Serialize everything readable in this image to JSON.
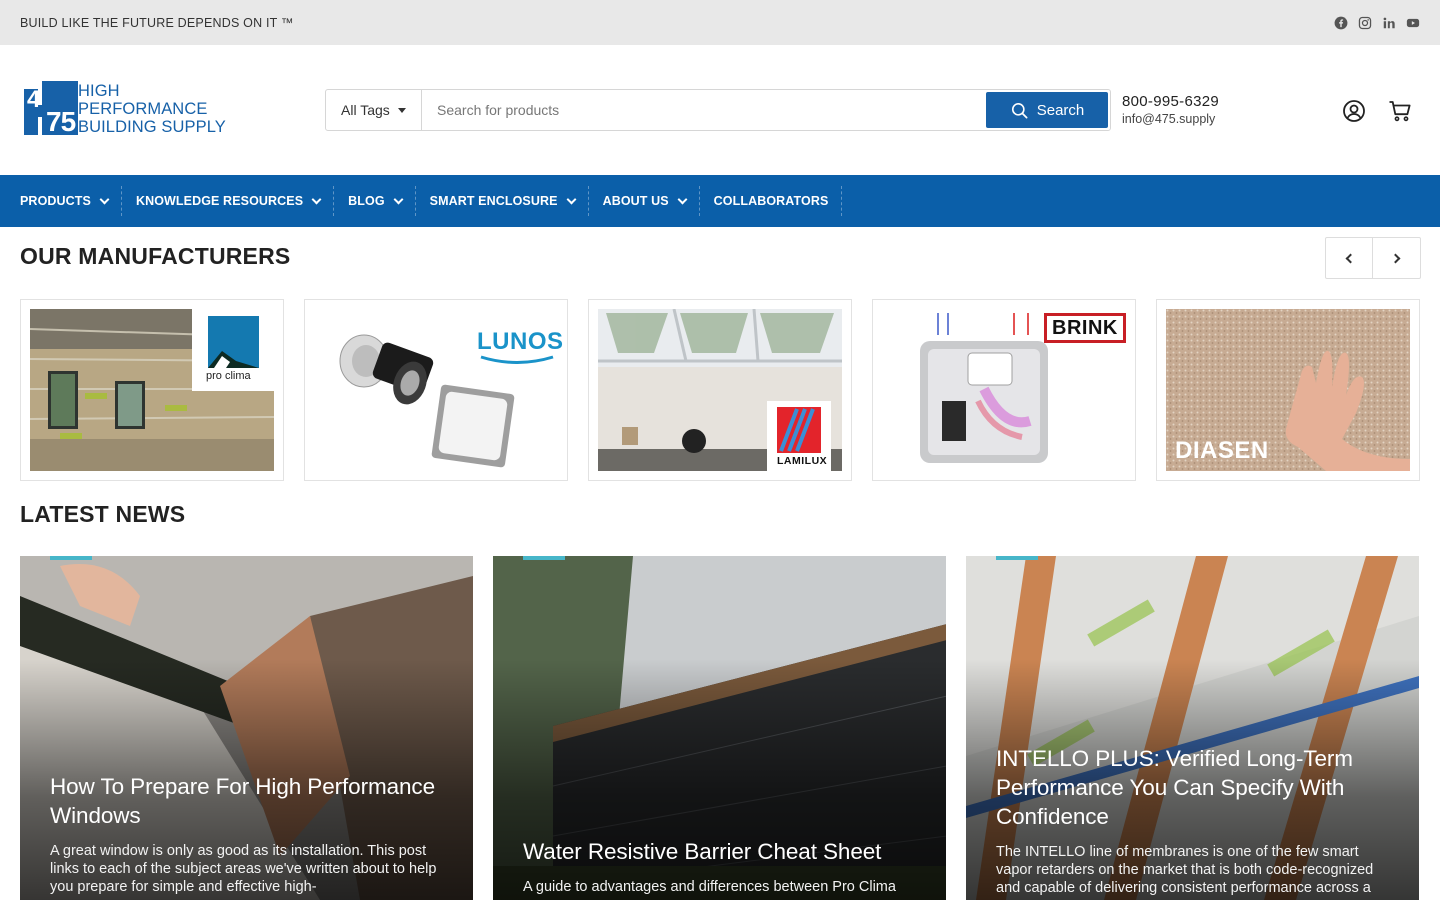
{
  "topbar": {
    "tagline": "BUILD LIKE THE FUTURE DEPENDS ON IT ™",
    "social": [
      "facebook-icon",
      "instagram-icon",
      "linkedin-icon",
      "youtube-icon"
    ]
  },
  "header": {
    "logo": {
      "numerals": "475",
      "line1": "HIGH",
      "line2": "PERFORMANCE",
      "line3": "BUILDING SUPPLY"
    },
    "search": {
      "tags_label": "All Tags",
      "placeholder": "Search for products",
      "button_label": "Search"
    },
    "contact": {
      "phone": "800-995-6329",
      "email": "info@475.supply"
    }
  },
  "nav": {
    "items": [
      {
        "label": "PRODUCTS",
        "has_menu": true
      },
      {
        "label": "KNOWLEDGE RESOURCES",
        "has_menu": true
      },
      {
        "label": "BLOG",
        "has_menu": true
      },
      {
        "label": "SMART ENCLOSURE",
        "has_menu": true
      },
      {
        "label": "ABOUT US",
        "has_menu": true
      },
      {
        "label": "COLLABORATORS",
        "has_menu": false
      }
    ]
  },
  "manufacturers": {
    "title": "OUR MANUFACTURERS",
    "items": [
      {
        "brand": "pro clima"
      },
      {
        "brand": "LUNOS"
      },
      {
        "brand": "LAMILUX"
      },
      {
        "brand": "BRINK"
      },
      {
        "brand": "DIASEN"
      }
    ]
  },
  "news": {
    "title": "LATEST NEWS",
    "items": [
      {
        "title": "How To Prepare For High Performance Windows",
        "excerpt": "A great window is only as good as its installation. This post links to each of the subject areas we've written about to help you prepare for simple and effective high-"
      },
      {
        "title": "Water Resistive Barrier Cheat Sheet",
        "excerpt": "A guide to advantages and differences between Pro Clima"
      },
      {
        "title": "INTELLO PLUS: Verified Long-Term Performance You Can Specify With Confidence",
        "excerpt": "The INTELLO line of membranes is one of the few smart vapor retarders on the market that is both code-recognized and capable of delivering consistent performance across a"
      }
    ]
  },
  "colors": {
    "brand_blue": "#1761a8",
    "nav_blue": "#0b5fa9",
    "topbar_bg": "#e8e8e8",
    "accent_teal": "#47b6c9"
  }
}
